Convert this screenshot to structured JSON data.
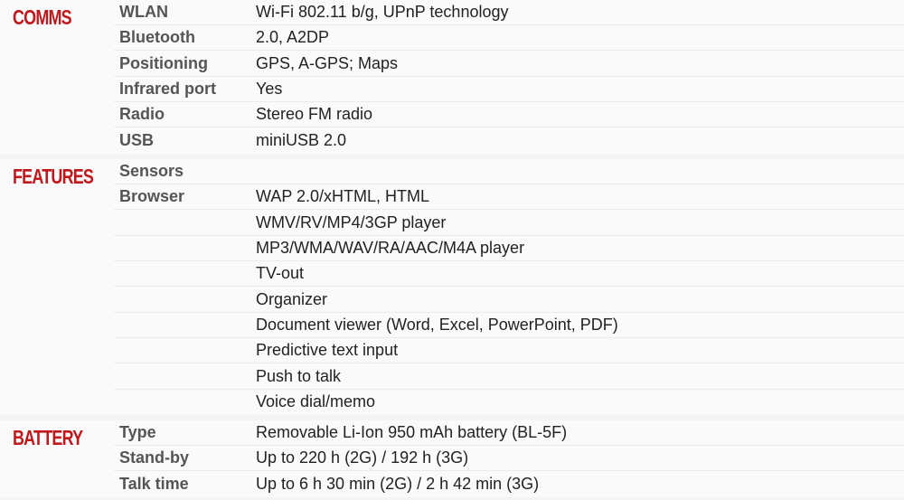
{
  "accent_color": "#c0191d",
  "comms": {
    "title": "COMMS",
    "rows": [
      {
        "key": "WLAN",
        "value": "Wi-Fi 802.11 b/g, UPnP technology"
      },
      {
        "key": "Bluetooth",
        "value": "2.0, A2DP"
      },
      {
        "key": "Positioning",
        "value": "GPS, A-GPS; Maps"
      },
      {
        "key": "Infrared port",
        "value": "Yes"
      },
      {
        "key": "Radio",
        "value": "Stereo FM radio"
      },
      {
        "key": "USB",
        "value": "miniUSB 2.0"
      }
    ]
  },
  "features": {
    "title": "FEATURES",
    "rows": [
      {
        "key": "Sensors",
        "value": ""
      },
      {
        "key": "Browser",
        "value": "WAP 2.0/xHTML, HTML"
      },
      {
        "key": "",
        "value": "WMV/RV/MP4/3GP player"
      },
      {
        "key": "",
        "value": "MP3/WMA/WAV/RA/AAC/M4A player"
      },
      {
        "key": "",
        "value": "TV-out"
      },
      {
        "key": "",
        "value": "Organizer"
      },
      {
        "key": "",
        "value": "Document viewer (Word, Excel, PowerPoint, PDF)"
      },
      {
        "key": "",
        "value": "Predictive text input"
      },
      {
        "key": "",
        "value": "Push to talk"
      },
      {
        "key": "",
        "value": "Voice dial/memo"
      }
    ]
  },
  "battery": {
    "title": "BATTERY",
    "rows": [
      {
        "key": "Type",
        "value": "Removable Li-Ion 950 mAh battery (BL-5F)"
      },
      {
        "key": "Stand-by",
        "value": "Up to 220 h (2G) / 192 h (3G)"
      },
      {
        "key": "Talk time",
        "value": "Up to 6 h 30 min (2G) / 2 h 42 min (3G)"
      }
    ]
  }
}
